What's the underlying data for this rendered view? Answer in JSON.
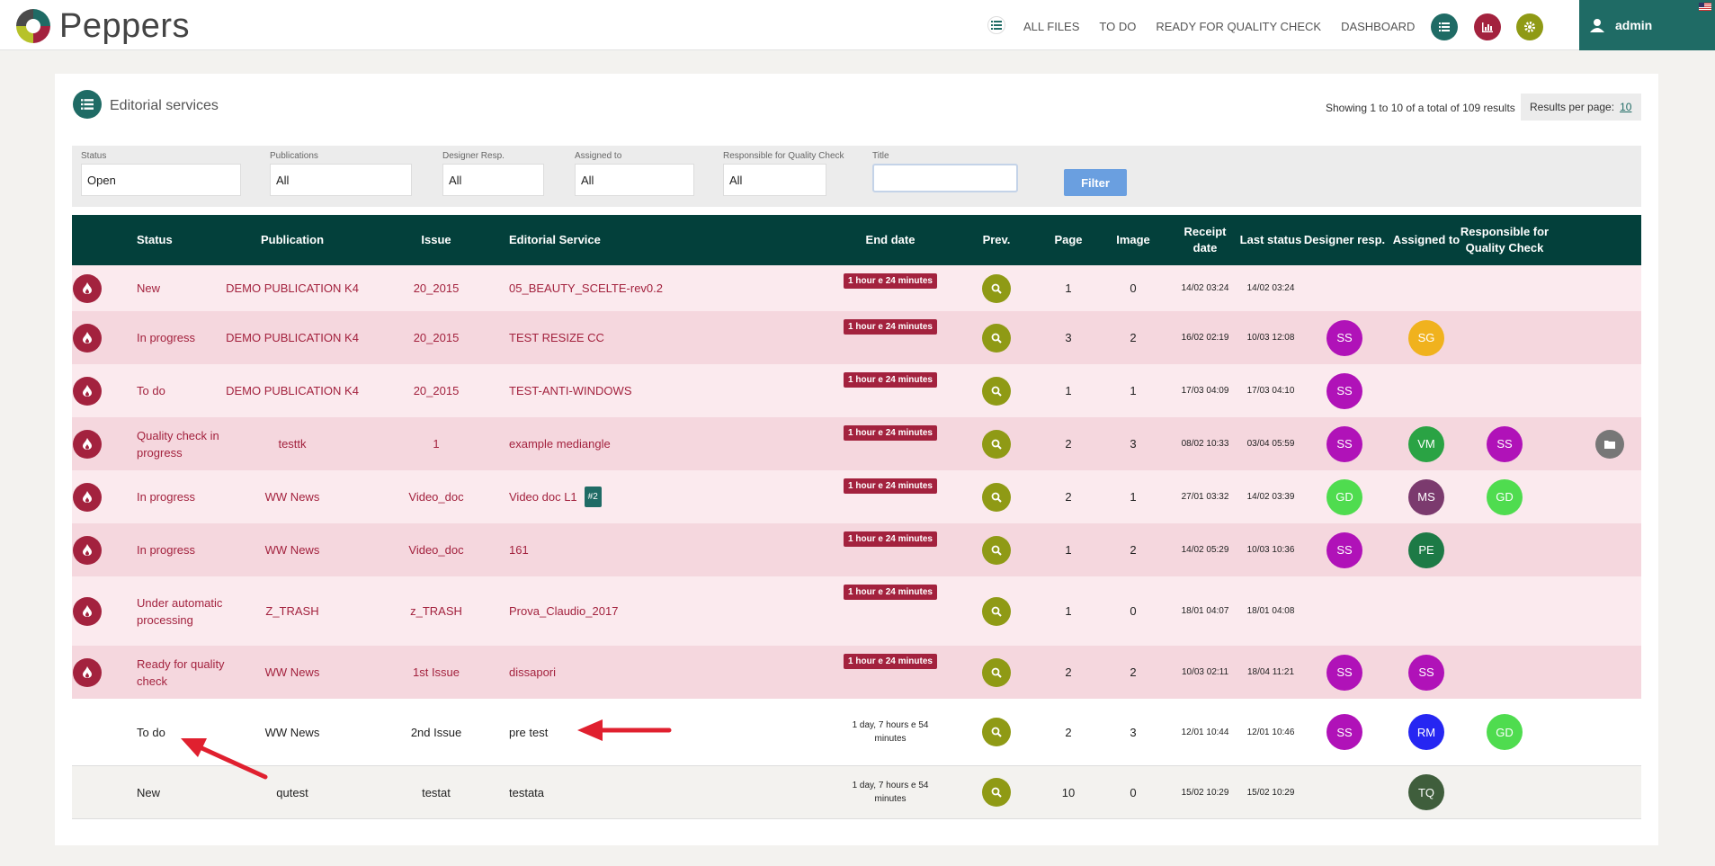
{
  "header": {
    "brand": "Peppers",
    "nav": [
      "ALL FILES",
      "TO DO",
      "READY FOR QUALITY CHECK",
      "DASHBOARD"
    ],
    "buttons": [
      {
        "icon": "list-icon",
        "color": "#1f6b65"
      },
      {
        "icon": "chart-icon",
        "color": "#a3223e"
      },
      {
        "icon": "gear-icon",
        "color": "#8f9a15"
      }
    ],
    "user": "admin"
  },
  "panel": {
    "title": "Editorial services",
    "showing": "Showing 1 to 10 of a total of 109 results",
    "rpp_label": "Results per page:",
    "rpp_value": "10"
  },
  "filters": {
    "status": {
      "label": "Status",
      "value": "Open"
    },
    "publications": {
      "label": "Publications",
      "value": "All"
    },
    "designer": {
      "label": "Designer Resp.",
      "value": "All"
    },
    "assigned": {
      "label": "Assigned to",
      "value": "All"
    },
    "qc": {
      "label": "Responsible for Quality Check",
      "value": "All"
    },
    "title": {
      "label": "Title",
      "value": ""
    },
    "button": "Filter"
  },
  "columns": {
    "status": "Status",
    "publication": "Publication",
    "issue": "Issue",
    "service": "Editorial Service",
    "end": "End date",
    "prev": "Prev.",
    "page": "Page",
    "image": "Image",
    "receipt": "Receipt date",
    "last": "Last status",
    "designer": "Designer resp.",
    "assigned": "Assigned to",
    "qc": "Responsible for Quality Check"
  },
  "colors": {
    "pink_light": "#fbeaee",
    "pink_dark": "#f5d7de",
    "white": "#ffffff",
    "grey": "#f3f2ef",
    "accent_red": "#a3223e",
    "teal": "#1f6b65"
  },
  "rows": [
    {
      "status": "New",
      "publication": "DEMO PUBLICATION K4",
      "issue": "20_2015",
      "service": "05_BEAUTY_SCELTE-rev0.2",
      "tag": "",
      "end": "1 hour e 24 minutes",
      "end_badge": true,
      "page": "1",
      "image": "0",
      "receipt": "14/02 03:24",
      "last": "14/02 03:24",
      "designer": "",
      "designer_color": "",
      "assigned": "",
      "assigned_color": "",
      "qc": "",
      "qc_color": "",
      "folder": false,
      "bg": "pink_light",
      "icon": true
    },
    {
      "status": "In progress",
      "publication": "DEMO PUBLICATION K4",
      "issue": "20_2015",
      "service": "TEST RESIZE CC",
      "tag": "",
      "end": "1 hour e 24 minutes",
      "end_badge": true,
      "page": "3",
      "image": "2",
      "receipt": "16/02 02:19",
      "last": "10/03 12:08",
      "designer": "SS",
      "designer_color": "#b012b8",
      "assigned": "SG",
      "assigned_color": "#f0b21e",
      "qc": "",
      "qc_color": "",
      "folder": false,
      "bg": "pink_dark",
      "icon": true
    },
    {
      "status": "To do",
      "publication": "DEMO PUBLICATION K4",
      "issue": "20_2015",
      "service": "TEST-ANTI-WINDOWS",
      "tag": "",
      "end": "1 hour e 24 minutes",
      "end_badge": true,
      "page": "1",
      "image": "1",
      "receipt": "17/03 04:09",
      "last": "17/03 04:10",
      "designer": "SS",
      "designer_color": "#b012b8",
      "assigned": "",
      "assigned_color": "",
      "qc": "",
      "qc_color": "",
      "folder": false,
      "bg": "pink_light",
      "icon": true
    },
    {
      "status": "Quality check in progress",
      "publication": "testtk",
      "issue": "1",
      "service": "example mediangle",
      "tag": "",
      "end": "1 hour e 24 minutes",
      "end_badge": true,
      "page": "2",
      "image": "3",
      "receipt": "08/02 10:33",
      "last": "03/04 05:59",
      "designer": "SS",
      "designer_color": "#b012b8",
      "assigned": "VM",
      "assigned_color": "#2aa344",
      "qc": "SS",
      "qc_color": "#b012b8",
      "folder": true,
      "bg": "pink_dark",
      "icon": true
    },
    {
      "status": "In progress",
      "publication": "WW News",
      "issue": "Video_doc",
      "service": "Video doc L1",
      "tag": "#2",
      "end": "1 hour e 24 minutes",
      "end_badge": true,
      "page": "2",
      "image": "1",
      "receipt": "27/01 03:32",
      "last": "14/02 03:39",
      "designer": "GD",
      "designer_color": "#4fdc4f",
      "assigned": "MS",
      "assigned_color": "#7b3a6e",
      "qc": "GD",
      "qc_color": "#4fdc4f",
      "folder": false,
      "bg": "pink_light",
      "icon": true
    },
    {
      "status": "In progress",
      "publication": "WW News",
      "issue": "Video_doc",
      "service": "161",
      "tag": "",
      "end": "1 hour e 24 minutes",
      "end_badge": true,
      "page": "1",
      "image": "2",
      "receipt": "14/02 05:29",
      "last": "10/03 10:36",
      "designer": "SS",
      "designer_color": "#b012b8",
      "assigned": "PE",
      "assigned_color": "#1d7a46",
      "qc": "",
      "qc_color": "",
      "folder": false,
      "bg": "pink_dark",
      "icon": true
    },
    {
      "status": "Under automatic processing",
      "publication": "Z_TRASH",
      "issue": "z_TRASH",
      "service": "Prova_Claudio_2017",
      "tag": "",
      "end": "1 hour e 24 minutes",
      "end_badge": true,
      "page": "1",
      "image": "0",
      "receipt": "18/01 04:07",
      "last": "18/01 04:08",
      "designer": "",
      "designer_color": "",
      "assigned": "",
      "assigned_color": "",
      "qc": "",
      "qc_color": "",
      "folder": false,
      "bg": "pink_light",
      "icon": true
    },
    {
      "status": "Ready for quality check",
      "publication": "WW News",
      "issue": "1st Issue",
      "service": "dissapori",
      "tag": "",
      "end": "1 hour e 24 minutes",
      "end_badge": true,
      "page": "2",
      "image": "2",
      "receipt": "10/03 02:11",
      "last": "18/04 11:21",
      "designer": "SS",
      "designer_color": "#b012b8",
      "assigned": "SS",
      "assigned_color": "#b012b8",
      "qc": "",
      "qc_color": "",
      "folder": false,
      "bg": "pink_dark",
      "icon": true
    },
    {
      "status": "To do",
      "publication": "WW News",
      "issue": "2nd Issue",
      "service": "pre test",
      "tag": "",
      "end": "1 day, 7 hours e 54 minutes",
      "end_badge": false,
      "page": "2",
      "image": "3",
      "receipt": "12/01 10:44",
      "last": "12/01 10:46",
      "designer": "SS",
      "designer_color": "#b012b8",
      "assigned": "RM",
      "assigned_color": "#2626f2",
      "qc": "GD",
      "qc_color": "#4fdc4f",
      "folder": false,
      "bg": "white",
      "icon": false
    },
    {
      "status": "New",
      "publication": "qutest",
      "issue": "testat",
      "service": "testata",
      "tag": "",
      "end": "1 day, 7 hours e 54 minutes",
      "end_badge": false,
      "page": "10",
      "image": "0",
      "receipt": "15/02 10:29",
      "last": "15/02 10:29",
      "designer": "",
      "designer_color": "",
      "assigned": "TQ",
      "assigned_color": "#3f5e3c",
      "qc": "",
      "qc_color": "",
      "folder": false,
      "bg": "grey",
      "icon": false
    }
  ]
}
